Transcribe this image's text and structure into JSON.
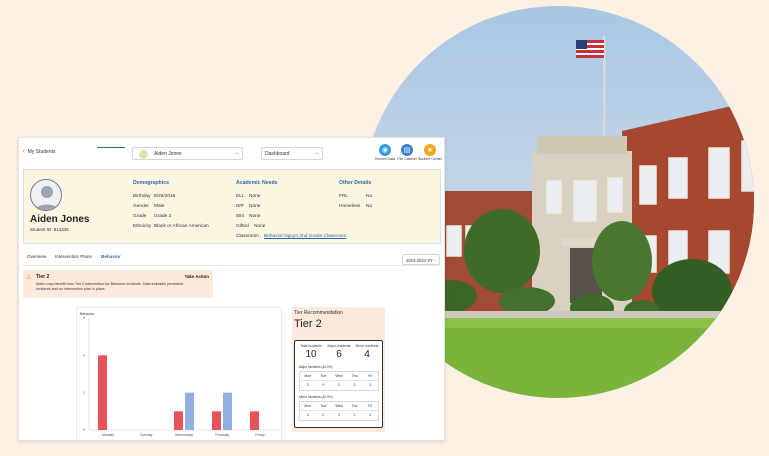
{
  "topbar": {
    "back_label": "My Students",
    "student_select": "Aiden Jones",
    "view_select": "Dashboard",
    "buttons": [
      {
        "label": "Record Data",
        "color": "#2f9be0",
        "icon": "record-icon"
      },
      {
        "label": "File Cabinet",
        "color": "#3b7fd0",
        "icon": "cabinet-icon"
      },
      {
        "label": "Student Center",
        "color": "#f2a818",
        "icon": "star-icon"
      }
    ]
  },
  "profile": {
    "name": "Aiden Jones",
    "id_label": "Student ID",
    "id_value": "813336",
    "demographics": {
      "title": "Demographics",
      "rows": [
        {
          "k": "Birthday",
          "v": "9/28/2016"
        },
        {
          "k": "Gender",
          "v": "Male"
        },
        {
          "k": "Grade",
          "v": "Grade 2"
        },
        {
          "k": "Ethnicity",
          "v": "Black or African American"
        }
      ]
    },
    "academic": {
      "title": "Academic Needs",
      "rows": [
        {
          "k": "ELL",
          "v": "None"
        },
        {
          "k": "IEP",
          "v": "None"
        },
        {
          "k": "504",
          "v": "None"
        },
        {
          "k": "Gifted",
          "v": "None"
        }
      ],
      "classroom_label": "Classroom",
      "classroom_value": "Behavior Nguyn 2nd Grade Classroom"
    },
    "other": {
      "title": "Other Details",
      "rows": [
        {
          "k": "FRL",
          "v": "No"
        },
        {
          "k": "Homeless",
          "v": "No"
        }
      ]
    }
  },
  "tabs": [
    "Overview",
    "Intervention Plans",
    "Behavior"
  ],
  "active_tab": "Behavior",
  "year_select": "2023-2024 SY",
  "alert": {
    "title": "Tier 2",
    "action": "Take Action",
    "message": "Aiden may benefit from Tier 2 intervention for Behavior incidents. Data indicates persistent incidents and no intervention plan in place."
  },
  "chart_data": {
    "type": "bar",
    "title": "Behavior",
    "categories": [
      "Monday",
      "Tuesday",
      "Wednesday",
      "Thursday",
      "Friday"
    ],
    "ylim": [
      0,
      6
    ],
    "yticks": [
      0,
      2,
      4,
      6
    ],
    "series": [
      {
        "name": "",
        "color": "#e8525b",
        "values": [
          4,
          0,
          1,
          1,
          1
        ]
      },
      {
        "name": "",
        "color": "#8fb0e0",
        "values": [
          0,
          0,
          2,
          2,
          0
        ]
      }
    ]
  },
  "recommendation": {
    "title": "Tier Recommendation",
    "tier": "Tier 2",
    "stats": [
      {
        "label": "Total Incidents",
        "value": "10"
      },
      {
        "label": "Major Incidents",
        "value": "6"
      },
      {
        "label": "Minor Incidents",
        "value": "4"
      }
    ],
    "major_label": "Major Incidents (40.0%)",
    "minor_label": "Minor Incidents (40.0%)",
    "days": [
      "Mon",
      "Tue",
      "Wed",
      "Thu",
      "Fri"
    ],
    "major_values": [
      "3",
      "0",
      "1",
      "1",
      "1"
    ],
    "minor_values": [
      "0",
      "0",
      "2",
      "2",
      "0"
    ]
  }
}
